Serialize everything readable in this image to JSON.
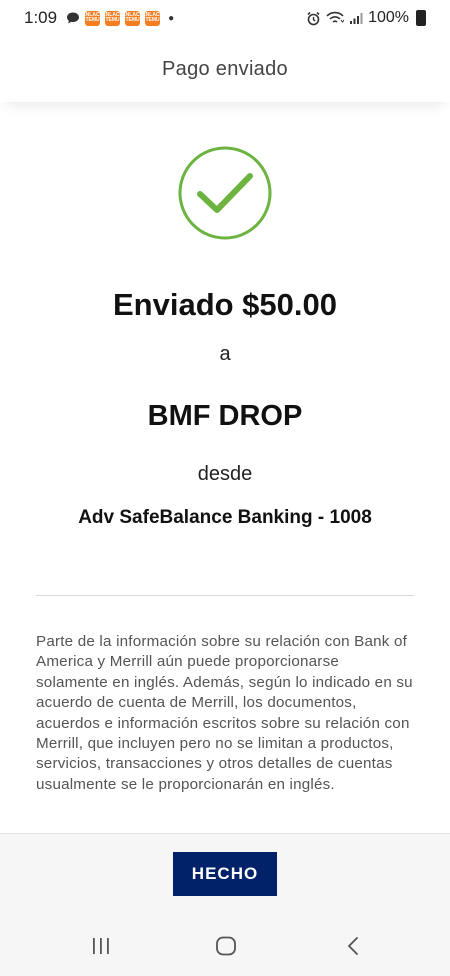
{
  "status_bar": {
    "time": "1:09",
    "notification_tiles": [
      "ENLACE TEMU",
      "ENLACE TEMU",
      "ENLACE TEMU",
      "ENLACE TEMU"
    ],
    "battery": "100%"
  },
  "header": {
    "title": "Pago enviado"
  },
  "confirmation": {
    "icon": "checkmark-circle-icon",
    "accent_color": "#6cb33f",
    "sent_line": "Enviado $50.00",
    "to_word": "a",
    "recipient": "BMF DROP",
    "from_word": "desde",
    "account": "Adv SafeBalance Banking - 1008"
  },
  "disclaimer": "Parte de la información sobre su relación con Bank of America y Merrill aún puede proporcionarse solamente en inglés. Además, según lo indicado en su acuerdo de cuenta de Merrill, los documentos, acuerdos e información escritos sobre su relación con Merrill, que incluyen pero no se limitan a productos, servicios, transacciones y otros detalles de cuentas usualmente se le proporcionarán en inglés.",
  "actions": {
    "done_label": "HECHO",
    "done_color": "#012169"
  },
  "nav_bar": {
    "icons": [
      "recent-apps-icon",
      "home-icon",
      "back-icon"
    ]
  }
}
